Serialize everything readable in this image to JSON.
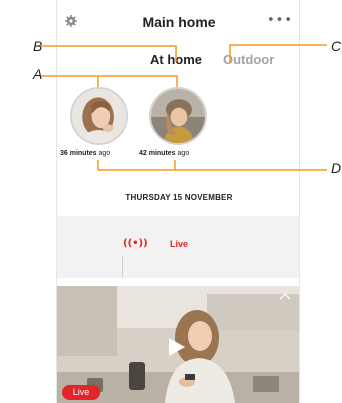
{
  "header": {
    "title": "Main home",
    "more_label": "•••"
  },
  "tabs": [
    {
      "label": "At home",
      "active": true
    },
    {
      "label": "Outdoor",
      "active": false
    }
  ],
  "people": [
    {
      "minutes": "36 minutes",
      "suffix": "ago"
    },
    {
      "minutes": "42 minutes",
      "suffix": "ago"
    }
  ],
  "date_label": "THURSDAY 15 NOVEMBER",
  "live": {
    "icon": "((•))",
    "label": "Live"
  },
  "video": {
    "badge": "Live"
  },
  "callouts": {
    "a": "A",
    "b": "B",
    "c": "C",
    "d": "D"
  },
  "colors": {
    "accent": "#e2242b",
    "inactive_tab": "#a3a3a3",
    "callout_line": "#f59a23"
  },
  "icons": [
    "settings-icon",
    "more-icon",
    "live-signal-icon",
    "play-icon",
    "chevron-up-icon"
  ]
}
